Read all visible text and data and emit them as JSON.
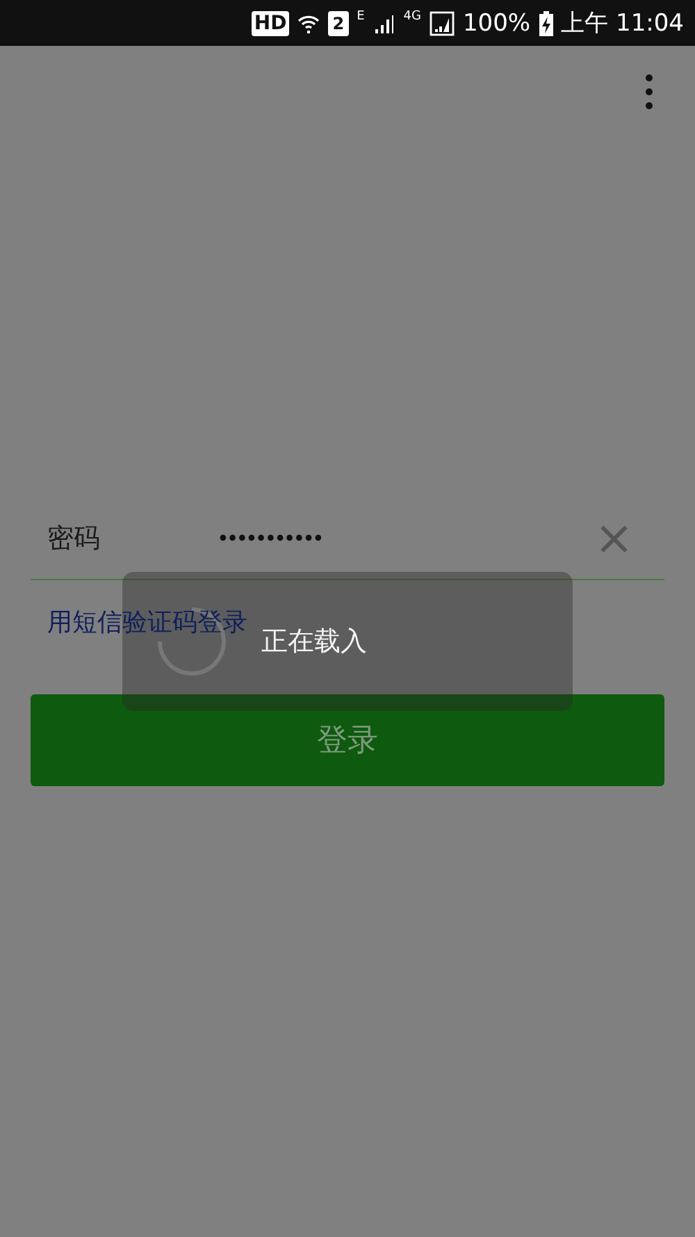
{
  "status_bar": {
    "hd": "HD",
    "sim": "2",
    "network_1": "E",
    "network_2": "4G",
    "battery": "100%",
    "time": "上午 11:04"
  },
  "password_row": {
    "label": "密码",
    "value": "•••••••••••",
    "clear": "×"
  },
  "sms_login_link": "用短信验证码登录",
  "login_button": {
    "label": "登录",
    "disabled": true
  },
  "loading_dialog": {
    "text": "正在载入"
  }
}
